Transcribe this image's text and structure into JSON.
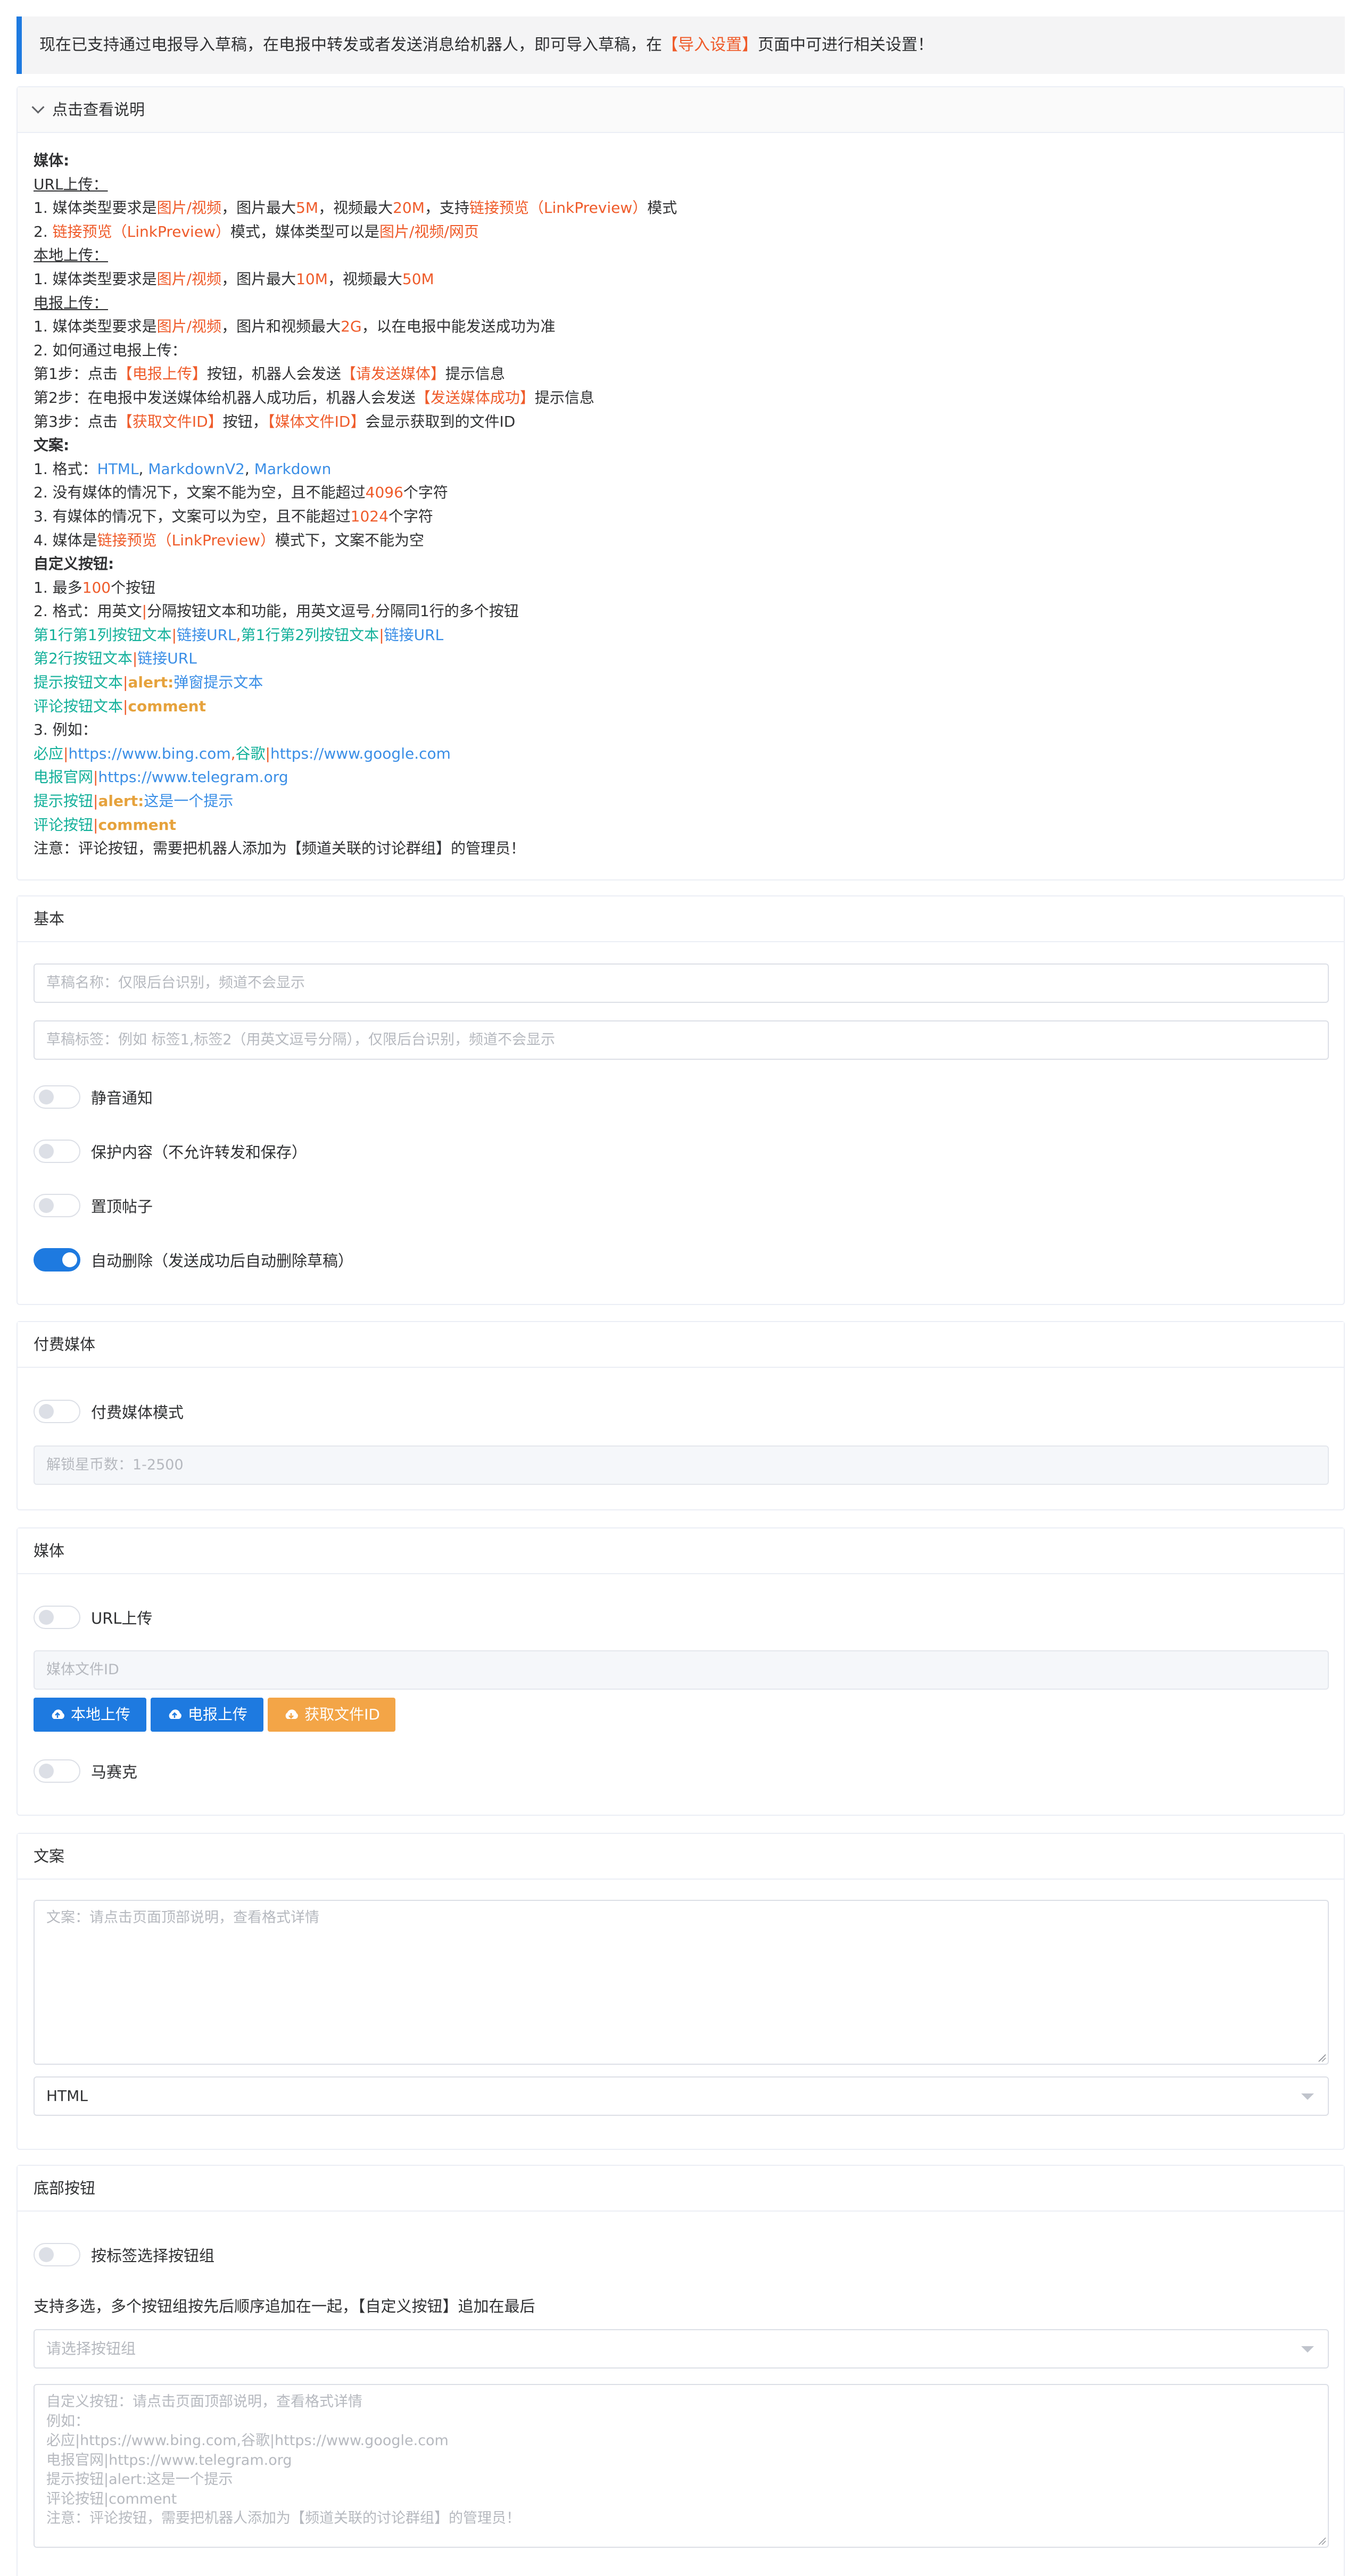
{
  "notice": {
    "before": "现在已支持通过电报导入草稿，在电报中转发或者发送消息给机器人，即可导入草稿，在",
    "link": "【导入设置】",
    "after": "页面中可进行相关设置！"
  },
  "help": {
    "toggle_label": "点击查看说明",
    "media_title": "媒体:",
    "url_upload_title": "URL上传：",
    "url_1": [
      "1. 媒体类型要求是",
      "图片/视频",
      "，图片最大",
      "5M",
      "，视频最大",
      "20M",
      "，支持",
      "链接预览（LinkPreview）",
      "模式"
    ],
    "url_2": [
      "2. ",
      "链接预览（LinkPreview）",
      "模式，媒体类型可以是",
      "图片/视频/网页"
    ],
    "local_upload_title": "本地上传：",
    "local_1": [
      "1. 媒体类型要求是",
      "图片/视频",
      "，图片最大",
      "10M",
      "，视频最大",
      "50M"
    ],
    "tg_upload_title": "电报上传：",
    "tg_1": [
      "1. 媒体类型要求是",
      "图片/视频",
      "，图片和视频最大",
      "2G",
      "，以在电报中能发送成功为准"
    ],
    "tg_2": "2. 如何通过电报上传：",
    "step1": [
      "第1步：点击",
      "【电报上传】",
      "按钮，机器人会发送",
      "【请发送媒体】",
      "提示信息"
    ],
    "step2": [
      "第2步：在电报中发送媒体给机器人成功后，机器人会发送",
      "【发送媒体成功】",
      "提示信息"
    ],
    "step3": [
      "第3步：点击",
      "【获取文件ID】",
      "按钮，",
      "【媒体文件ID】",
      "会显示获取到的文件ID"
    ],
    "text_title": "文案:",
    "text_1": [
      "1. 格式：",
      "HTML",
      ", ",
      "MarkdownV2",
      ", ",
      "Markdown"
    ],
    "text_2": [
      "2. 没有媒体的情况下，文案不能为空，且不能超过",
      "4096",
      "个字符"
    ],
    "text_3": [
      "3. 有媒体的情况下，文案可以为空，且不能超过",
      "1024",
      "个字符"
    ],
    "text_4": [
      "4. 媒体是",
      "链接预览（LinkPreview）",
      "模式下，文案不能为空"
    ],
    "btn_title": "自定义按钮:",
    "btn_1": [
      "1. 最多",
      "100",
      "个按钮"
    ],
    "btn_2": [
      "2. 格式：用英文",
      "|",
      "分隔按钮文本和功能，用英文逗号",
      ",",
      "分隔同1行的多个按钮"
    ],
    "fmt_1": [
      "第1行第1列按钮文本",
      "|",
      "链接URL",
      ",",
      "第1行第2列按钮文本",
      "|",
      "链接URL"
    ],
    "fmt_2": [
      "第2行按钮文本",
      "|",
      "链接URL"
    ],
    "fmt_3": [
      "提示按钮文本",
      "|",
      "alert:",
      "弹窗提示文本"
    ],
    "fmt_4": [
      "评论按钮文本",
      "|",
      "comment"
    ],
    "btn_3": "3. 例如：",
    "ex_1": [
      "必应",
      "|",
      "https://www.bing.com",
      ",",
      "谷歌",
      "|",
      "https://www.google.com"
    ],
    "ex_2": [
      "电报官网",
      "|",
      "https://www.telegram.org"
    ],
    "ex_3": [
      "提示按钮",
      "|",
      "alert:",
      "这是一个提示"
    ],
    "ex_4": [
      "评论按钮",
      "|",
      "comment"
    ],
    "note": "注意：评论按钮，需要把机器人添加为【频道关联的讨论群组】的管理员！"
  },
  "basic": {
    "title": "基本",
    "name_placeholder": "草稿名称：仅限后台识别，频道不会显示",
    "tags_placeholder": "草稿标签：例如 标签1,标签2（用英文逗号分隔），仅限后台识别，频道不会显示",
    "silent": "静音通知",
    "protect": "保护内容（不允许转发和保存）",
    "pin": "置顶帖子",
    "auto_delete": "自动删除（发送成功后自动删除草稿）"
  },
  "paid": {
    "title": "付费媒体",
    "mode": "付费媒体模式",
    "stars_placeholder": "解锁星币数：1-2500"
  },
  "media": {
    "title": "媒体",
    "url_upload": "URL上传",
    "file_id_placeholder": "媒体文件ID",
    "local_btn": "本地上传",
    "tg_btn": "电报上传",
    "get_id_btn": "获取文件ID",
    "mosaic": "马赛克"
  },
  "text": {
    "title": "文案",
    "placeholder": "文案：请点击页面顶部说明，查看格式详情",
    "format": "HTML"
  },
  "buttons": {
    "title": "底部按钮",
    "by_tag": "按标签选择按钮组",
    "multi_note": "支持多选，多个按钮组按先后顺序追加在一起，【自定义按钮】追加在最后",
    "group_placeholder": "请选择按钮组",
    "custom_placeholder": [
      "自定义按钮：请点击页面顶部说明，查看格式详情",
      "例如：",
      "必应|https://www.bing.com,谷歌|https://www.google.com",
      "电报官网|https://www.telegram.org",
      "提示按钮|alert:这是一个提示",
      "评论按钮|comment",
      "注意：评论按钮，需要把机器人添加为【频道关联的讨论群组】的管理员！"
    ]
  },
  "colors": {
    "accent": "#1e7ae0",
    "highlight": "#ef5b2a",
    "link": "#3a8ee6",
    "teal": "#13b09a",
    "orange": "#e6a23c"
  }
}
